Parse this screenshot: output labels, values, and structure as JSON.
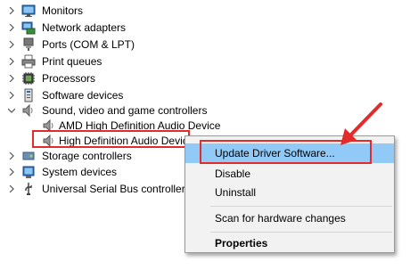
{
  "tree": {
    "items": [
      {
        "label": "Monitors",
        "icon": "monitor-icon",
        "expanded": false
      },
      {
        "label": "Network adapters",
        "icon": "network-adapter-icon",
        "expanded": false
      },
      {
        "label": "Ports (COM & LPT)",
        "icon": "port-icon",
        "expanded": false
      },
      {
        "label": "Print queues",
        "icon": "printer-icon",
        "expanded": false
      },
      {
        "label": "Processors",
        "icon": "processor-icon",
        "expanded": false
      },
      {
        "label": "Software devices",
        "icon": "software-device-icon",
        "expanded": false
      },
      {
        "label": "Sound, video and game controllers",
        "icon": "speaker-icon",
        "expanded": true
      },
      {
        "label": "Storage controllers",
        "icon": "storage-icon",
        "expanded": false
      },
      {
        "label": "System devices",
        "icon": "system-device-icon",
        "expanded": false
      },
      {
        "label": "Universal Serial Bus controllers",
        "icon": "usb-icon",
        "expanded": false
      }
    ],
    "sound_children": [
      {
        "label": "AMD High Definition Audio Device",
        "icon": "speaker-icon"
      },
      {
        "label": "High Definition Audio Devic",
        "icon": "speaker-icon",
        "selected": true
      }
    ]
  },
  "context_menu": {
    "items": [
      {
        "label": "Update Driver Software...",
        "highlighted": true
      },
      {
        "label": "Disable"
      },
      {
        "label": "Uninstall"
      },
      {
        "label": "Scan for hardware changes"
      },
      {
        "label": "Properties",
        "bold": true
      }
    ]
  },
  "annotation": {
    "box_color": "#e32b2b",
    "arrow_color": "#e32b2b"
  }
}
